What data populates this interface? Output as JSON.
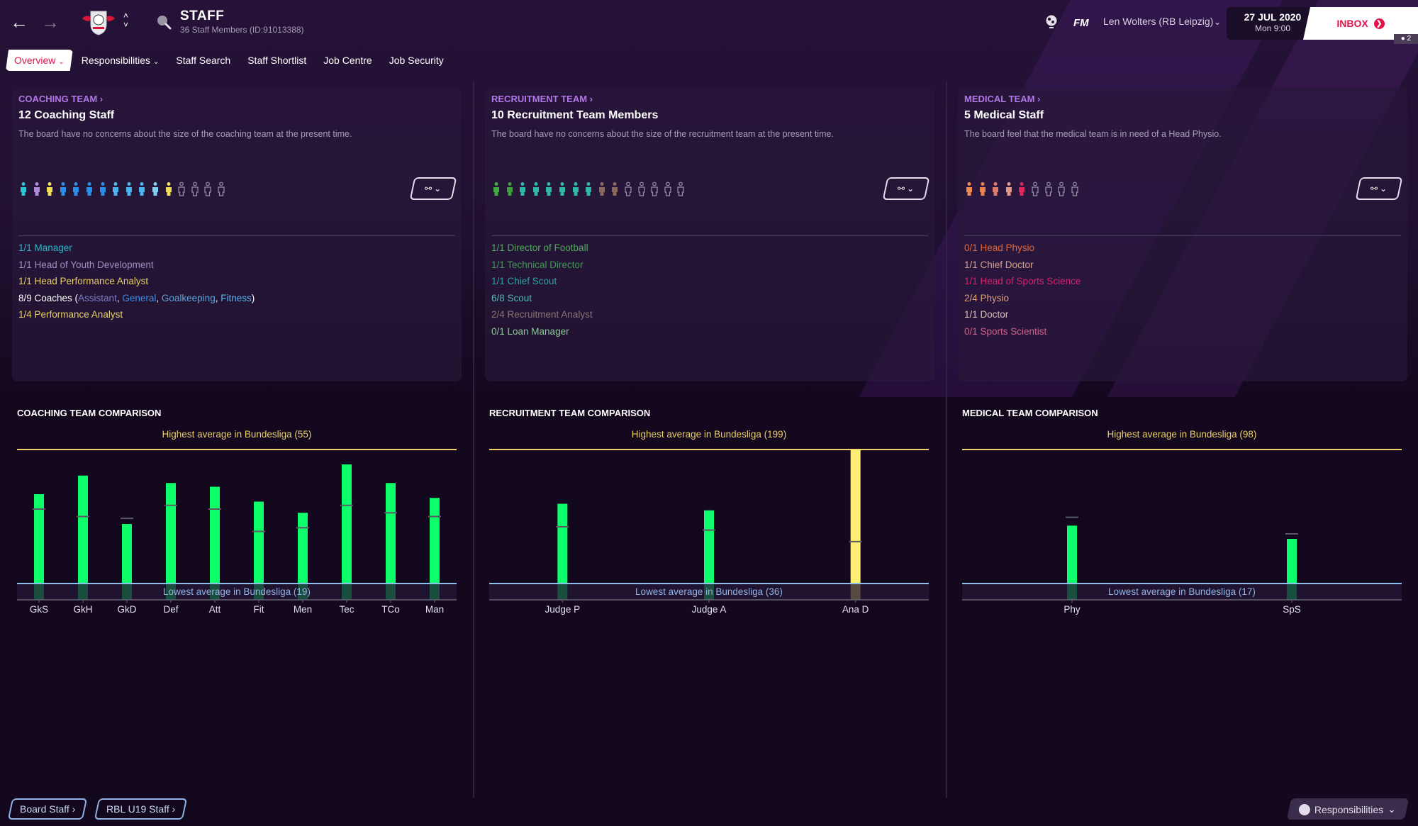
{
  "header": {
    "back_icon": "arrow-left-icon",
    "forward_icon": "arrow-right-icon",
    "club_badge": "rb-leipzig-badge",
    "title": "STAFF",
    "subtitle": "36 Staff Members (ID:91013388)",
    "search_icon": "search-icon",
    "globe_icon": "globe-icon",
    "fm_label": "FM",
    "manager": "Len Wolters (RB Leipzig)",
    "date": "27 JUL 2020",
    "time": "Mon 9:00",
    "inbox_label": "INBOX",
    "inbox_count": "2"
  },
  "tabs": [
    {
      "label": "Overview",
      "active": true,
      "dropdown": true
    },
    {
      "label": "Responsibilities",
      "active": false,
      "dropdown": true
    },
    {
      "label": "Staff Search",
      "active": false,
      "dropdown": false
    },
    {
      "label": "Staff Shortlist",
      "active": false,
      "dropdown": false
    },
    {
      "label": "Job Centre",
      "active": false,
      "dropdown": false
    },
    {
      "label": "Job Security",
      "active": false,
      "dropdown": false
    }
  ],
  "panels": [
    {
      "kicker": "COACHING TEAM",
      "title": "12 Coaching Staff",
      "description": "The board have no concerns about the size of the coaching team at the present time.",
      "figures": [
        "#2ec4d6",
        "#b08ad9",
        "#f2de5a",
        "#2b8fe8",
        "#2b8fe8",
        "#2b8fe8",
        "#2b8fe8",
        "#4cb4ee",
        "#4cb4ee",
        "#4cb4ee",
        "#7fd0f5",
        "#f2de5a",
        "empty",
        "empty",
        "empty",
        "empty"
      ],
      "roles": [
        {
          "text": "1/1 Manager",
          "color": "#2fb4cc"
        },
        {
          "text": "1/1 Head of Youth Development",
          "color": "#a08fc2"
        },
        {
          "text": "1/1 Head Performance Analyst",
          "color": "#e8cf6a"
        },
        {
          "text": "8/9 Coaches (",
          "color": "#ffffff",
          "parts": [
            {
              "text": "8/9 Coaches (",
              "color": "#ffffff"
            },
            {
              "text": "Assistant",
              "color": "#7c7ec9"
            },
            {
              "text": ", ",
              "color": "#ffffff"
            },
            {
              "text": "General",
              "color": "#3f8ee0"
            },
            {
              "text": ", ",
              "color": "#ffffff"
            },
            {
              "text": "Goalkeeping",
              "color": "#5fa3d9"
            },
            {
              "text": ", ",
              "color": "#ffffff"
            },
            {
              "text": "Fitness",
              "color": "#5ab4f0"
            },
            {
              "text": ")",
              "color": "#ffffff"
            }
          ]
        },
        {
          "text": "1/4 Performance Analyst",
          "color": "#e8cf6a"
        }
      ]
    },
    {
      "kicker": "RECRUITMENT TEAM",
      "title": "10 Recruitment Team Members",
      "description": "The board have no concerns about the size of the recruitment team at the present time.",
      "figures": [
        "#3fae3f",
        "#3f9f3f",
        "#2fb8a8",
        "#2fb8a8",
        "#2fb8a8",
        "#2fb8a8",
        "#2fb8a8",
        "#2fb8a8",
        "#8a6a5a",
        "#8a6a5a",
        "empty",
        "empty",
        "empty",
        "empty",
        "empty"
      ],
      "roles": [
        {
          "text": "1/1 Director of Football",
          "color": "#4faa5a"
        },
        {
          "text": "1/1 Technical Director",
          "color": "#3d9a4f"
        },
        {
          "text": "1/1 Chief Scout",
          "color": "#2aa3a3"
        },
        {
          "text": "6/8 Scout",
          "color": "#53b8b8"
        },
        {
          "text": "2/4 Recruitment Analyst",
          "color": "#8a7574"
        },
        {
          "text": "0/1 Loan Manager",
          "color": "#8dc79a"
        }
      ]
    },
    {
      "kicker": "MEDICAL TEAM",
      "title": "5 Medical Staff",
      "description": "The board feel that the medical team is in need of a Head Physio.",
      "figures": [
        "#f08a55",
        "#e8854f",
        "#e07a6a",
        "#e09a8a",
        "#e0285e",
        "empty",
        "empty",
        "empty",
        "empty"
      ],
      "roles": [
        {
          "text": "0/1 Head Physio",
          "color": "#e0673a"
        },
        {
          "text": "1/1 Chief Doctor",
          "color": "#d8a08a"
        },
        {
          "text": "1/1 Head of Sports Science",
          "color": "#d6246a"
        },
        {
          "text": "2/4 Physio",
          "color": "#e4a07a"
        },
        {
          "text": "1/1 Doctor",
          "color": "#d8c0b6"
        },
        {
          "text": "0/1 Sports Scientist",
          "color": "#d0608a"
        }
      ]
    }
  ],
  "add_staff_icon": "add-staff-icon",
  "chart_data": [
    {
      "type": "bar",
      "title": "COACHING TEAM COMPARISON",
      "high_label": "Highest average in Bundesliga (55)",
      "low_label": "Lowest average in Bundesliga (19)",
      "ylim": [
        19,
        55
      ],
      "categories": [
        "GkS",
        "GkH",
        "GkD",
        "Def",
        "Att",
        "Fit",
        "Men",
        "Tec",
        "TCo",
        "Man"
      ],
      "values": [
        43,
        48,
        35,
        46,
        45,
        41,
        38,
        51,
        46,
        42
      ],
      "league_average": [
        39,
        37,
        36.5,
        40,
        39,
        33,
        34,
        40,
        38,
        37
      ],
      "bar_colors": [
        "#0dff6a",
        "#0dff6a",
        "#0dff6a",
        "#0dff6a",
        "#0dff6a",
        "#0dff6a",
        "#0dff6a",
        "#0dff6a",
        "#0dff6a",
        "#0dff6a"
      ]
    },
    {
      "type": "bar",
      "title": "RECRUITMENT TEAM COMPARISON",
      "high_label": "Highest average in Bundesliga (199)",
      "low_label": "Lowest average in Bundesliga (36)",
      "ylim": [
        36,
        199
      ],
      "categories": [
        "Judge P",
        "Judge A",
        "Ana D"
      ],
      "values": [
        133,
        125,
        199
      ],
      "league_average": [
        105,
        101,
        87
      ],
      "bar_colors": [
        "#0dff6a",
        "#0dff6a",
        "#ffee73"
      ]
    },
    {
      "type": "bar",
      "title": "MEDICAL TEAM COMPARISON",
      "high_label": "Highest average in Bundesliga (98)",
      "low_label": "Lowest average in Bundesliga (17)",
      "ylim": [
        17,
        98
      ],
      "categories": [
        "Phy",
        "SpS"
      ],
      "values": [
        52,
        44
      ],
      "league_average": [
        57,
        47
      ],
      "bar_colors": [
        "#0dff6a",
        "#0dff6a"
      ]
    }
  ],
  "footer": {
    "board_staff": "Board Staff",
    "u19_staff": "RBL U19 Staff",
    "responsibilities": "Responsibilities"
  },
  "colors": {
    "accent": "#e0144a",
    "kicker": "#b277e6",
    "high_line": "#f2d16b",
    "low_line": "#8fc0ee"
  }
}
